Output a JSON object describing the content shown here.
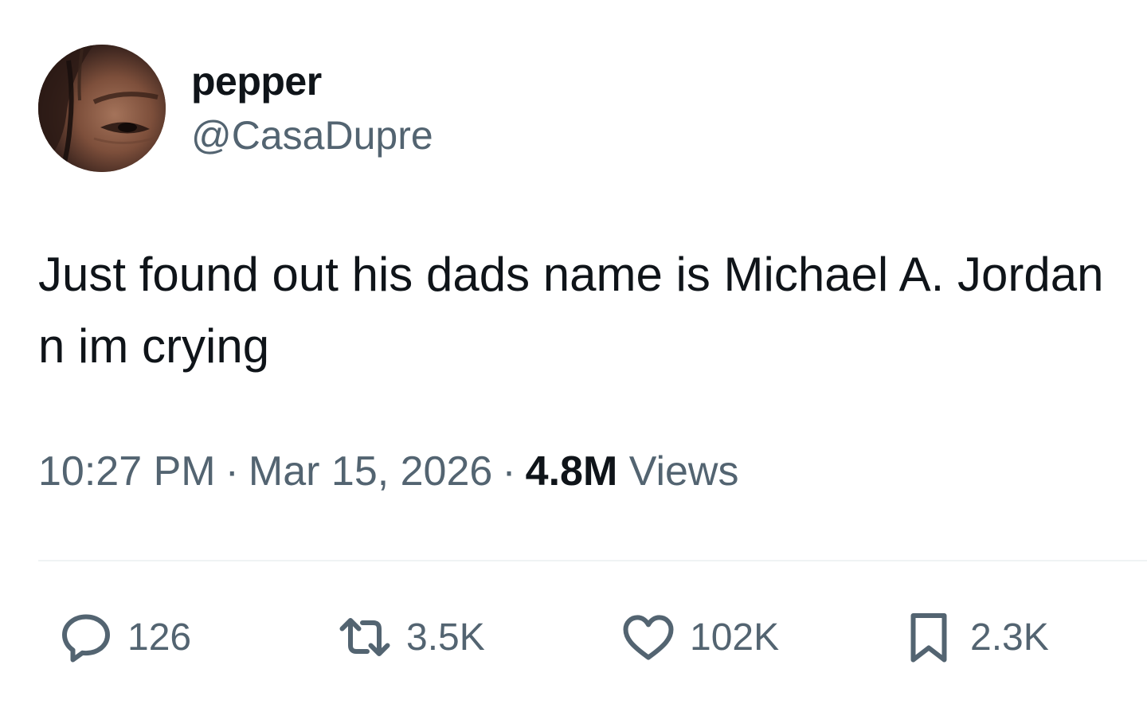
{
  "author": {
    "display_name": "pepper",
    "handle": "@CasaDupre",
    "avatar_icon": "profile-photo"
  },
  "tweet": {
    "text": "Just found out his dads name is Michael A. Jordan n im crying",
    "time": "10:27 PM",
    "date": "Mar 15, 2026",
    "separator": "·",
    "views_count": "4.8M",
    "views_label": "Views"
  },
  "actions": {
    "reply": {
      "icon": "reply-icon",
      "count": "126"
    },
    "repost": {
      "icon": "repost-icon",
      "count": "3.5K"
    },
    "like": {
      "icon": "heart-icon",
      "count": "102K"
    },
    "bookmark": {
      "icon": "bookmark-icon",
      "count": "2.3K"
    }
  },
  "colors": {
    "text_primary": "#0f1419",
    "text_secondary": "#536471",
    "divider": "#eff3f4",
    "background": "#ffffff"
  }
}
